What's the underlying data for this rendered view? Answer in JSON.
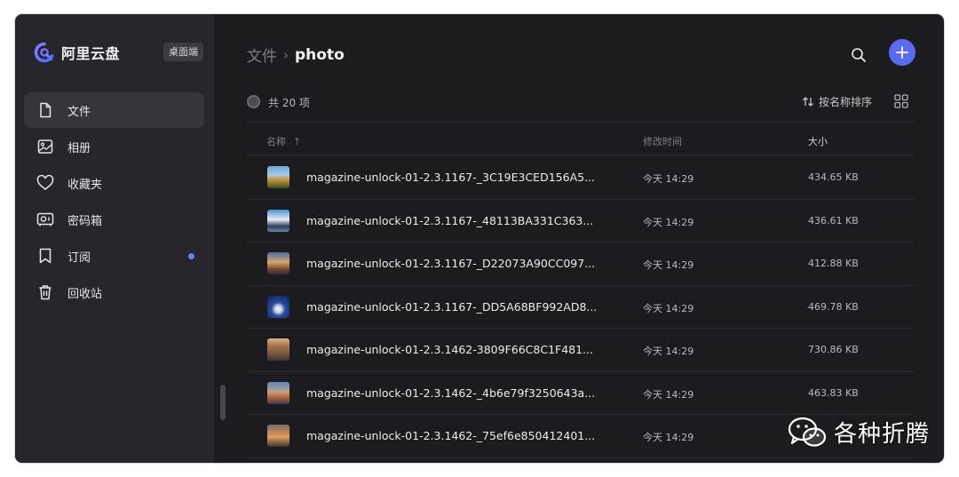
{
  "app": {
    "brand_name": "阿里云盘",
    "badge": "桌面端"
  },
  "sidebar": {
    "items": [
      {
        "label": "文件",
        "icon": "file-icon"
      },
      {
        "label": "相册",
        "icon": "photo-album-icon"
      },
      {
        "label": "收藏夹",
        "icon": "heart-icon"
      },
      {
        "label": "密码箱",
        "icon": "safe-box-icon"
      },
      {
        "label": "订阅",
        "icon": "bookmark-icon"
      },
      {
        "label": "回收站",
        "icon": "trash-icon"
      }
    ]
  },
  "breadcrumb": {
    "root": "文件",
    "separator": "›",
    "current": "photo"
  },
  "toolbar": {
    "count_label": "共 20 项",
    "sort_label": "按名称排序"
  },
  "table": {
    "headers": {
      "name": "名称",
      "sort_arrow": "↑",
      "time": "修改时间",
      "size": "大小"
    },
    "rows": [
      {
        "name": "magazine-unlock-01-2.3.1167-_3C19E3CED156A5...",
        "time": "今天 14:29",
        "size": "434.65 KB"
      },
      {
        "name": "magazine-unlock-01-2.3.1167-_48113BA331C363...",
        "time": "今天 14:29",
        "size": "436.61 KB"
      },
      {
        "name": "magazine-unlock-01-2.3.1167-_D22073A90CC097...",
        "time": "今天 14:29",
        "size": "412.88 KB"
      },
      {
        "name": "magazine-unlock-01-2.3.1167-_DD5A68BF992AD8...",
        "time": "今天 14:29",
        "size": "469.78 KB"
      },
      {
        "name": "magazine-unlock-01-2.3.1462-3809F66C8C1F481...",
        "time": "今天 14:29",
        "size": "730.86 KB"
      },
      {
        "name": "magazine-unlock-01-2.3.1462-_4b6e79f3250643a...",
        "time": "今天 14:29",
        "size": "463.83 KB"
      },
      {
        "name": "magazine-unlock-01-2.3.1462-_75ef6e850412401...",
        "time": "今天 14:29",
        "size": ""
      }
    ]
  },
  "watermark": {
    "text": "各种折腾"
  },
  "colors": {
    "accent": "#5a6bf2",
    "sidebar_bg": "#26262c",
    "main_bg": "#1c1c20",
    "notify_dot": "#6d7cff"
  }
}
